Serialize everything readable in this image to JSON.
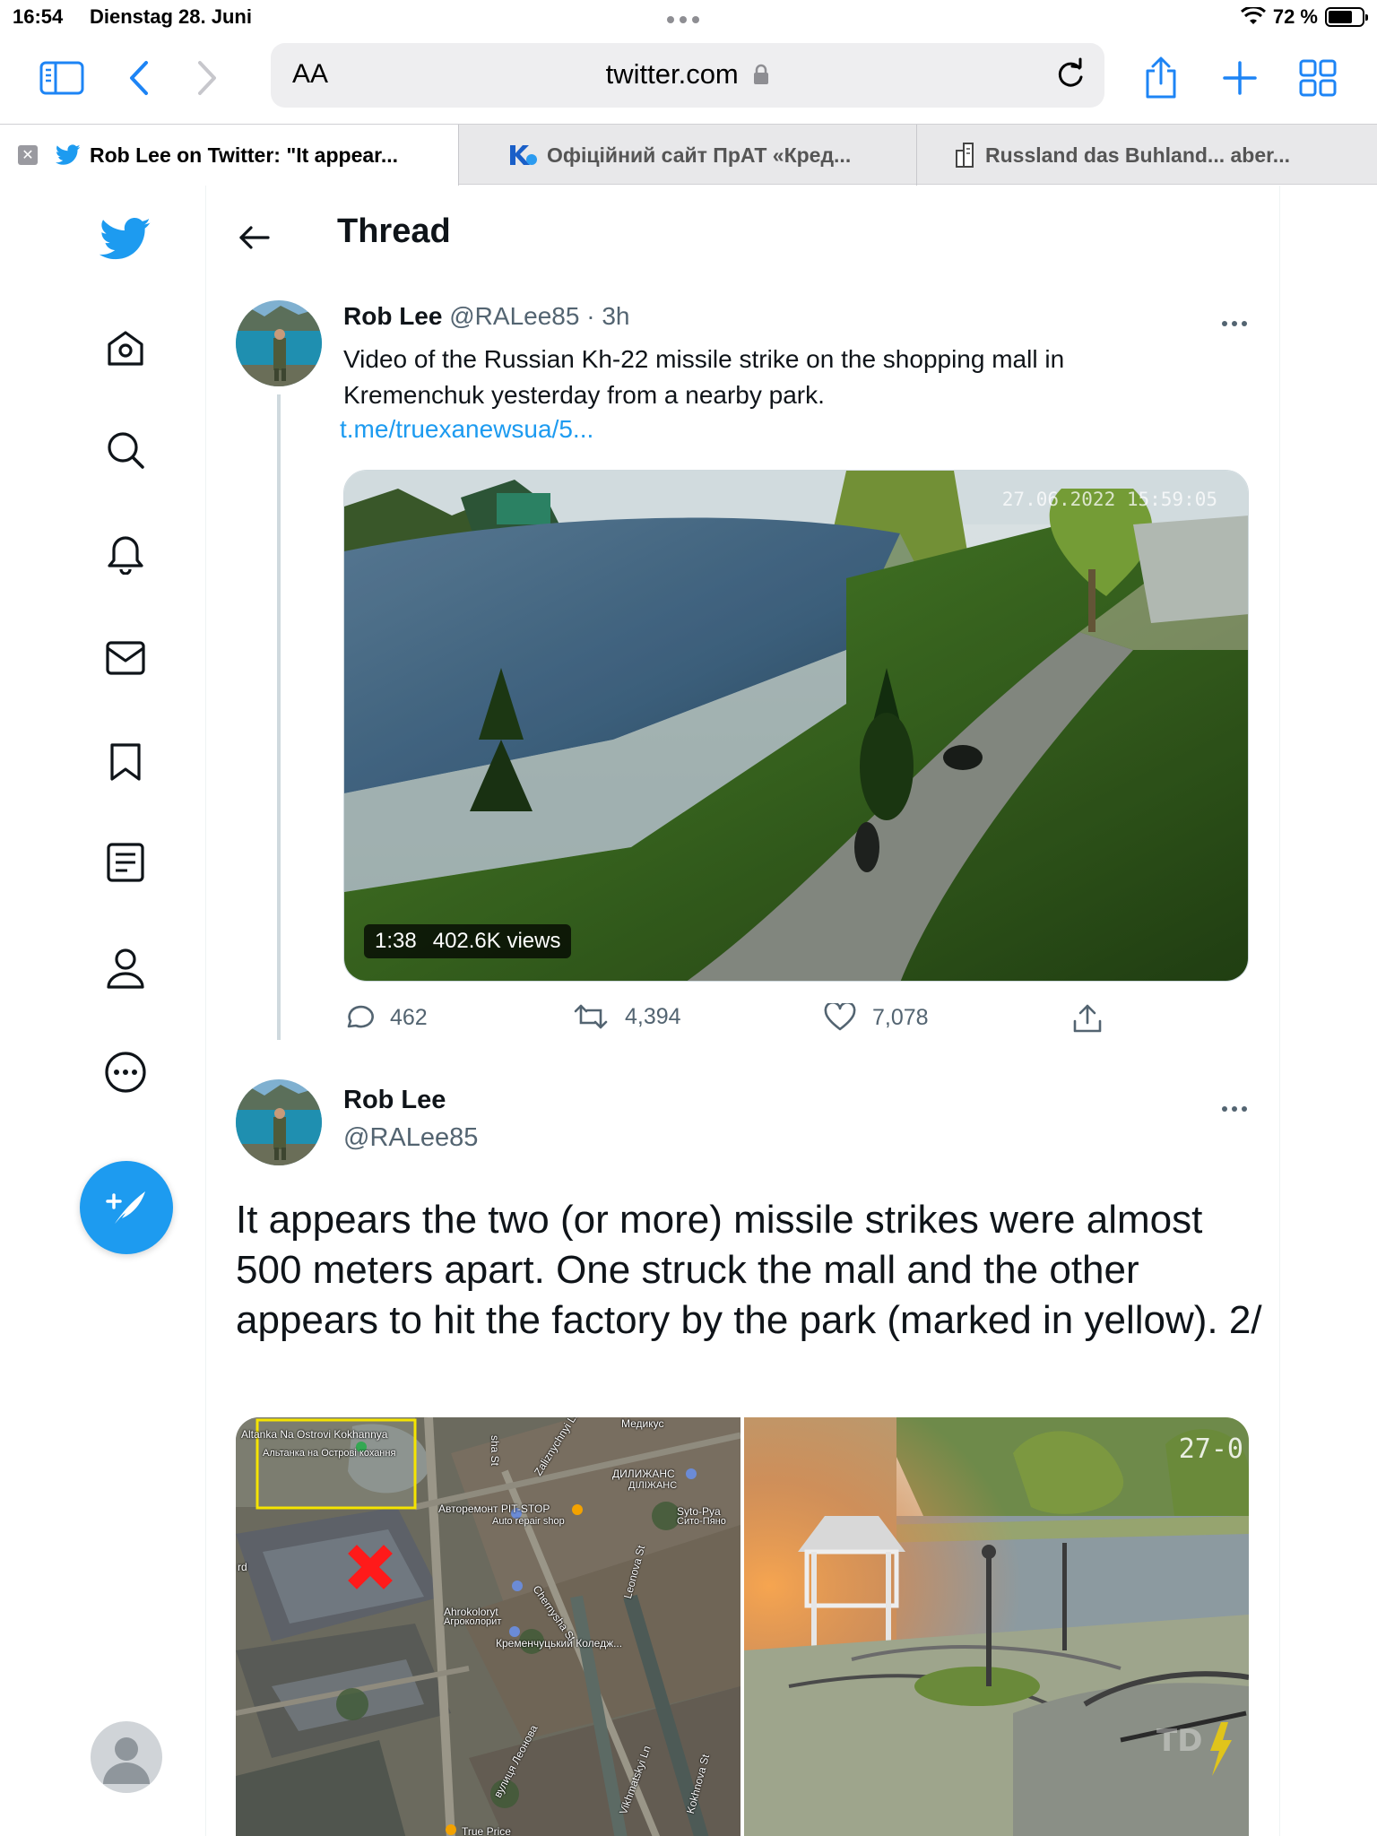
{
  "status_bar": {
    "time": "16:54",
    "date": "Dienstag 28. Juni",
    "battery_percent": "72 %",
    "battery_level": 0.72
  },
  "browser": {
    "text_size_button": "AA",
    "url": "twitter.com",
    "tabs": [
      {
        "title": "Rob Lee on Twitter: \"It appear...",
        "active": true
      },
      {
        "title": "Офіційний сайт ПрАТ «Кред...",
        "active": false
      },
      {
        "title": "Russland das Buhland... aber...",
        "active": false
      }
    ]
  },
  "page": {
    "title": "Thread"
  },
  "tweet1": {
    "name": "Rob Lee",
    "handle": "@RALee85",
    "time": "· 3h",
    "text": "Video of the Russian Kh-22 missile strike on the shopping mall in Kremenchuk yesterday from a nearby park.",
    "link": "t.me/truexanewsua/5...",
    "video": {
      "timestamp": "27.06.2022 15:59:05",
      "duration": "1:38",
      "views": "402.6K views"
    },
    "actions": {
      "replies": "462",
      "retweets": "4,394",
      "likes": "7,078"
    }
  },
  "tweet2": {
    "name": "Rob Lee",
    "handle": "@RALee85",
    "text": "It appears the two (or more) missile strikes were almost 500 meters apart. One struck the mall and the other appears to hit the factory by the park (marked in yellow). 2/",
    "map_labels": [
      "Altanka Na Ostrovi Kokhannya",
      "Альтанка на Острові кохання",
      "Медикус",
      "Zaliznychnyi Ln",
      "ДИЛИЖАНС",
      "ДІЛІЖАНС",
      "Автоpeмонт PIT-STOP",
      "Auto repair shop",
      "Syto-Pya",
      "Сито-Пяно",
      "Chernysha St",
      "Leonova St",
      "Ahrokoloryt",
      "Агроколорит",
      "Кременчуцький Коледж...",
      "вулиця Леонова",
      "Vikhmatskyi Ln",
      "Kokhnova St",
      "True Price",
      "sha St",
      "rd"
    ],
    "photo_timestamp": "27-0"
  },
  "colors": {
    "accent": "#1d9bf0",
    "text_primary": "#0f1419",
    "text_secondary": "#536471",
    "map_highlight": "#f5e400",
    "strike_marker": "#ff1a1a"
  }
}
